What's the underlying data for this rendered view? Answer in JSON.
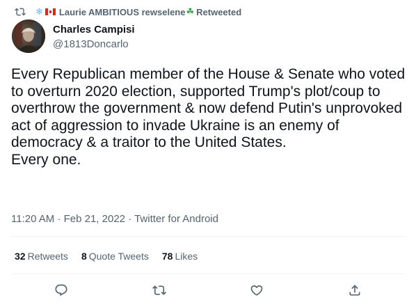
{
  "retweet_context": {
    "user": "Laurie AMBITIOUS rewselene",
    "suffix": "Retweeted"
  },
  "author": {
    "name": "Charles Campisi",
    "handle": "@1813Doncarlo"
  },
  "tweet": {
    "text": "Every Republican member of the House & Senate who voted to overturn 2020 election, supported Trump's plot/coup to overthrow the government & now defend Putin's unprovoked act of aggression to invade Ukraine is an enemy of democracy & a traitor to the United States.\nEvery one."
  },
  "meta": {
    "time": "11:20 AM",
    "date": "Feb 21, 2022",
    "source": "Twitter for Android",
    "separator": "·"
  },
  "stats": {
    "retweets_count": "32",
    "retweets_label": "Retweets",
    "quotes_count": "8",
    "quotes_label": "Quote Tweets",
    "likes_count": "78",
    "likes_label": "Likes"
  },
  "icons": {
    "retweet_context": "retweet-icon",
    "reply": "reply-icon",
    "retweet": "retweet-icon",
    "like": "heart-icon",
    "share": "share-icon"
  },
  "colors": {
    "text": "#0f1419",
    "secondary": "#536471",
    "divider": "#eff3f4"
  }
}
